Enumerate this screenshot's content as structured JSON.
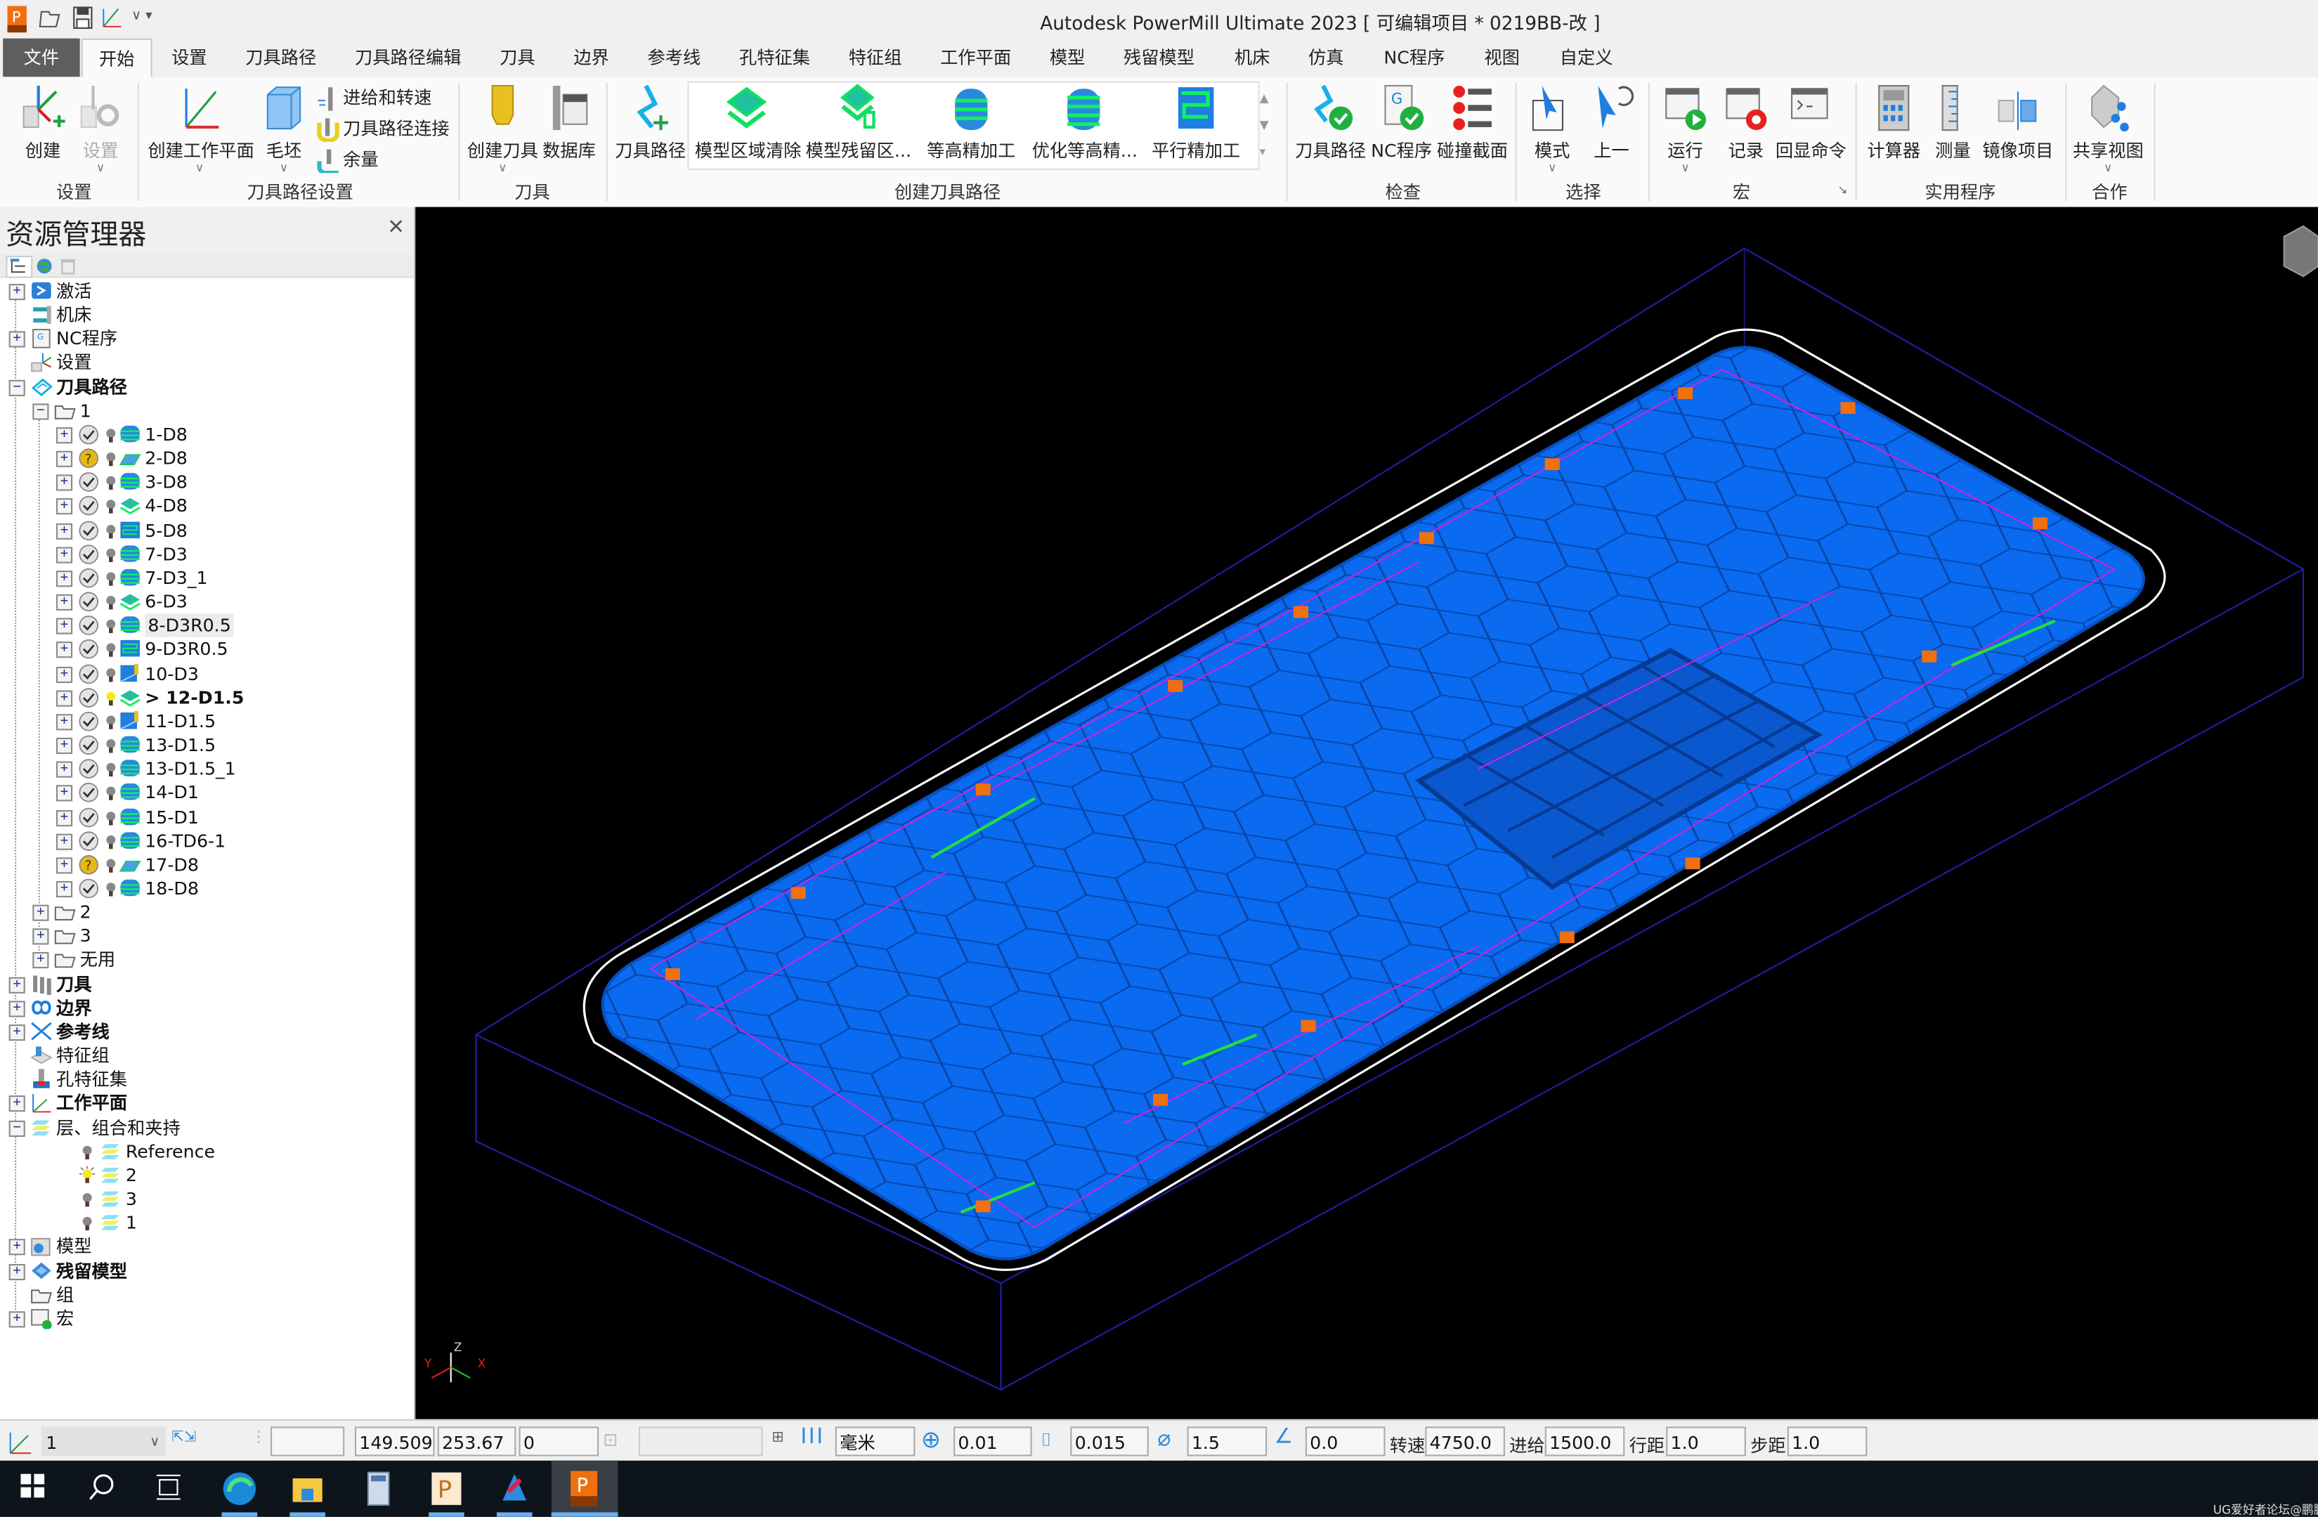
{
  "window": {
    "title": "Autodesk PowerMill Ultimate 2023    [ 可编辑项目 * 0219BB-改 ]"
  },
  "tabs": [
    "文件",
    "开始",
    "设置",
    "刀具路径",
    "刀具路径编辑",
    "刀具",
    "边界",
    "参考线",
    "孔特征集",
    "特征组",
    "工作平面",
    "模型",
    "残留模型",
    "机床",
    "仿真",
    "NC程序",
    "视图",
    "自定义"
  ],
  "active_tab": "开始",
  "ribbon": {
    "groups": [
      "设置",
      "刀具路径设置",
      "刀具",
      "创建刀具路径",
      "检查",
      "选择",
      "宏",
      "实用程序",
      "合作"
    ],
    "buttons": {
      "create": "创建",
      "setup": "设置",
      "create_workplane": "创建工作平面",
      "block": "毛坯",
      "feeds_speeds": "进给和转速",
      "toolpath_connect": "刀具路径连接",
      "thickness": "余量",
      "create_tool": "创建刀具",
      "database": "数据库",
      "toolpath": "刀具路径",
      "model_area_clear": "模型区域清除",
      "model_rest_area": "模型残留区...",
      "constant_z": "等高精加工",
      "optimized_constant_z": "优化等高精...",
      "raster_finish": "平行精加工",
      "verify_toolpath": "刀具路径",
      "verify_nc": "NC程序",
      "collision_section": "碰撞截面",
      "mode": "模式",
      "previous": "上一",
      "run": "运行",
      "record": "记录",
      "echo": "回显命令",
      "calculator": "计算器",
      "measure": "测量",
      "mirror": "镜像项目",
      "share_view": "共享视图"
    }
  },
  "explorer": {
    "title": "资源管理器",
    "tree": [
      {
        "label": "激活",
        "level": 0,
        "exp": "+",
        "icon": "activate"
      },
      {
        "label": "机床",
        "level": 0,
        "exp": "",
        "icon": "machine"
      },
      {
        "label": "NC程序",
        "level": 0,
        "exp": "+",
        "icon": "nc"
      },
      {
        "label": "设置",
        "level": 0,
        "exp": "",
        "icon": "setup"
      },
      {
        "label": "刀具路径",
        "level": 0,
        "exp": "-",
        "icon": "toolpaths",
        "bold": true
      },
      {
        "label": "1",
        "level": 1,
        "exp": "-",
        "icon": "folder"
      },
      {
        "label": "1-D8",
        "level": 2,
        "exp": "+",
        "status": "ok",
        "icon": "zlevel"
      },
      {
        "label": "2-D8",
        "level": 2,
        "exp": "+",
        "status": "question",
        "icon": "flat"
      },
      {
        "label": "3-D8",
        "level": 2,
        "exp": "+",
        "status": "ok",
        "icon": "zlevel"
      },
      {
        "label": "4-D8",
        "level": 2,
        "exp": "+",
        "status": "ok",
        "icon": "areaclear"
      },
      {
        "label": "5-D8",
        "level": 2,
        "exp": "+",
        "status": "ok",
        "icon": "raster"
      },
      {
        "label": "7-D3",
        "level": 2,
        "exp": "+",
        "status": "ok",
        "icon": "zlevel"
      },
      {
        "label": "7-D3_1",
        "level": 2,
        "exp": "+",
        "status": "ok",
        "icon": "zlevel"
      },
      {
        "label": "6-D3",
        "level": 2,
        "exp": "+",
        "status": "ok",
        "icon": "areaclear"
      },
      {
        "label": "8-D3R0.5",
        "level": 2,
        "exp": "+",
        "status": "ok",
        "icon": "zlevel",
        "highlight": true
      },
      {
        "label": "9-D3R0.5",
        "level": 2,
        "exp": "+",
        "status": "ok",
        "icon": "raster"
      },
      {
        "label": "10-D3",
        "level": 2,
        "exp": "+",
        "status": "ok",
        "icon": "corner"
      },
      {
        "label": "> 12-D1.5",
        "level": 2,
        "exp": "+",
        "status": "ok",
        "icon": "areaclear",
        "bold": true,
        "active": true
      },
      {
        "label": "11-D1.5",
        "level": 2,
        "exp": "+",
        "status": "ok",
        "icon": "corner"
      },
      {
        "label": "13-D1.5",
        "level": 2,
        "exp": "+",
        "status": "ok",
        "icon": "zlevel"
      },
      {
        "label": "13-D1.5_1",
        "level": 2,
        "exp": "+",
        "status": "ok",
        "icon": "zlevel"
      },
      {
        "label": "14-D1",
        "level": 2,
        "exp": "+",
        "status": "ok",
        "icon": "zlevel"
      },
      {
        "label": "15-D1",
        "level": 2,
        "exp": "+",
        "status": "ok",
        "icon": "zlevel"
      },
      {
        "label": "16-TD6-1",
        "level": 2,
        "exp": "+",
        "status": "ok",
        "icon": "zlevel"
      },
      {
        "label": "17-D8",
        "level": 2,
        "exp": "+",
        "status": "question",
        "icon": "flat"
      },
      {
        "label": "18-D8",
        "level": 2,
        "exp": "+",
        "status": "ok",
        "icon": "zlevel"
      },
      {
        "label": "2",
        "level": 1,
        "exp": "+",
        "icon": "folder"
      },
      {
        "label": "3",
        "level": 1,
        "exp": "+",
        "icon": "folder"
      },
      {
        "label": "无用",
        "level": 1,
        "exp": "+",
        "icon": "folder"
      },
      {
        "label": "刀具",
        "level": 0,
        "exp": "+",
        "icon": "tools",
        "bold": true
      },
      {
        "label": "边界",
        "level": 0,
        "exp": "+",
        "icon": "boundary",
        "bold": true
      },
      {
        "label": "参考线",
        "level": 0,
        "exp": "+",
        "icon": "pattern",
        "bold": true
      },
      {
        "label": "特征组",
        "level": 0,
        "exp": "",
        "icon": "featureset"
      },
      {
        "label": "孔特征集",
        "level": 0,
        "exp": "",
        "icon": "holes"
      },
      {
        "label": "工作平面",
        "level": 0,
        "exp": "+",
        "icon": "workplane",
        "bold": true
      },
      {
        "label": "层、组合和夹持",
        "level": 0,
        "exp": "-",
        "icon": "layers"
      },
      {
        "label": "Reference",
        "level": 3,
        "exp": "",
        "icon": "layers",
        "bulb": "off"
      },
      {
        "label": "2",
        "level": 3,
        "exp": "",
        "icon": "layers",
        "bulb": "on"
      },
      {
        "label": "3",
        "level": 3,
        "exp": "",
        "icon": "layers",
        "bulb": "off"
      },
      {
        "label": "1",
        "level": 3,
        "exp": "",
        "icon": "layers",
        "bulb": "off"
      },
      {
        "label": "模型",
        "level": 0,
        "exp": "+",
        "icon": "model"
      },
      {
        "label": "残留模型",
        "level": 0,
        "exp": "+",
        "icon": "stock",
        "bold": true
      },
      {
        "label": "组",
        "level": 0,
        "exp": "",
        "icon": "folder"
      },
      {
        "label": "宏",
        "level": 0,
        "exp": "+",
        "icon": "macro"
      }
    ]
  },
  "statusbar": {
    "workplane": "1",
    "x": "149.509",
    "y": "253.67",
    "z": "0",
    "units": "毫米",
    "tolerance": "0.01",
    "thickness": "0.015",
    "diameter": "1.5",
    "angle": "0.0",
    "spindle_label": "转速",
    "spindle": "4750.0",
    "feed_label": "进给",
    "feed": "1500.0",
    "stepover_label": "行距",
    "stepover": "1.0",
    "stepdown_label": "步距",
    "stepdown": "1.0"
  },
  "viewport": {
    "triad": {
      "z": "Z",
      "x": "X",
      "y": "Y"
    }
  },
  "watermark": "UG爱好者论坛@鹏鹏*",
  "colors": {
    "part": "#0a6af0",
    "toolpath": "#d020e0",
    "stock_box": "#1e1ea0",
    "accent": "#2b7cd3"
  }
}
